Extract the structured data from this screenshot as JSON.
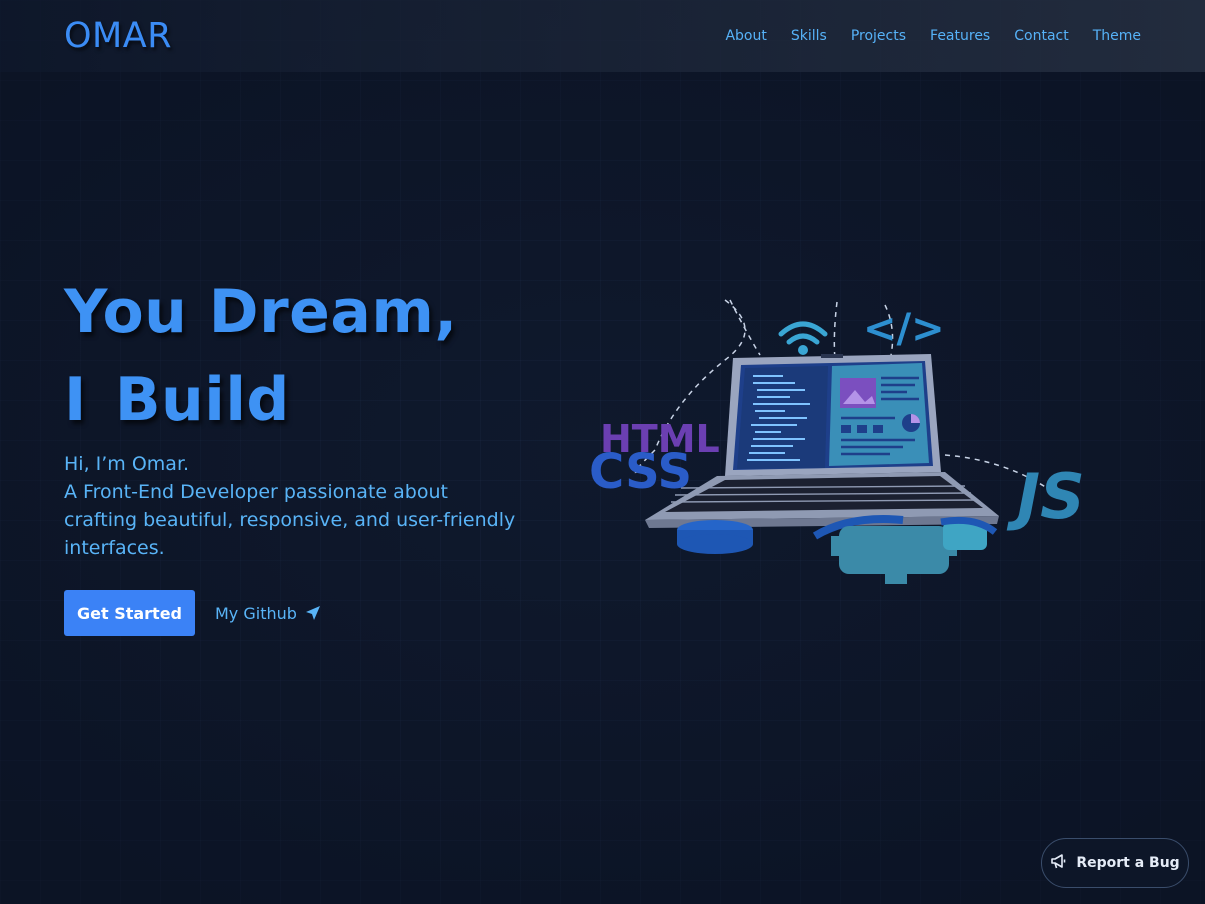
{
  "nav": {
    "logo": "OMAR",
    "links": [
      "About",
      "Skills",
      "Projects",
      "Features",
      "Contact",
      "Theme"
    ]
  },
  "hero": {
    "title_line1": "You Dream,",
    "title_line2_a": "I",
    "title_line2_b": "Build",
    "greeting": "Hi, I’m Omar.",
    "description": "A Front-End Developer passionate about crafting beautiful, responsive, and user-friendly interfaces.",
    "cta_primary": "Get Started",
    "cta_secondary": "My Github"
  },
  "illustration": {
    "tags": [
      "HTML",
      "CSS",
      "</>",
      "JS"
    ]
  },
  "report": {
    "label": "Report a Bug"
  },
  "colors": {
    "background": "#0f192d",
    "accent": "#3b82f6",
    "text_accent": "#59b4f7"
  },
  "icons": [
    "paper-plane-icon",
    "megaphone-icon",
    "wifi-icon",
    "laptop-illustration"
  ]
}
